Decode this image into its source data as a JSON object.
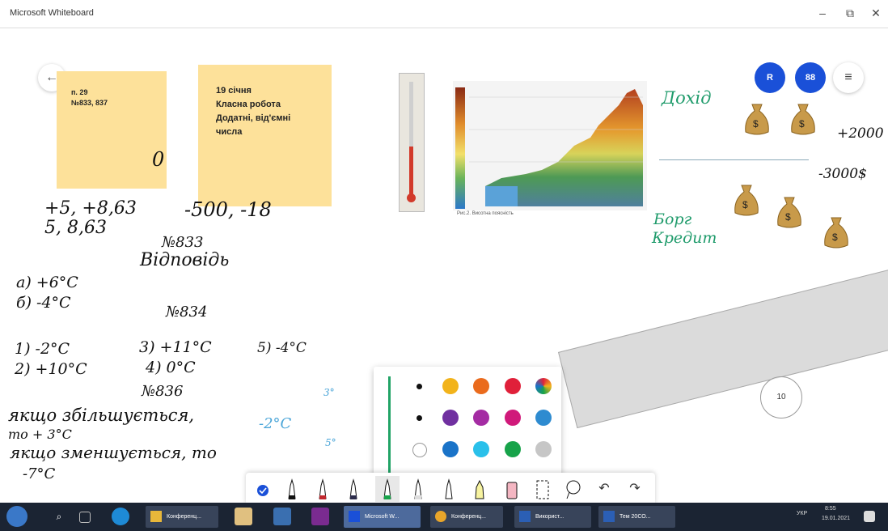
{
  "window": {
    "title": "Microsoft Whiteboard",
    "min": "–",
    "max": "⧉",
    "close": "✕"
  },
  "nav": {
    "back_icon": "←"
  },
  "sticky_notes": [
    {
      "lines": [
        "п. 29",
        "№833, 837"
      ]
    },
    {
      "lines": [
        "19 січня",
        "Класна робота",
        "Додатні, від'ємні",
        "числа"
      ]
    }
  ],
  "top_buttons": {
    "user_initials": "R",
    "second": "88",
    "menu": "≡"
  },
  "ink_notes": {
    "zero": "0",
    "pair1": "+5, +8,63",
    "pair2": "5, 8,63",
    "pair3": "-500, -18",
    "n833": "№833",
    "vidpovid": "Відповідь",
    "a": "а) +6°C",
    "b": "б) -4°C",
    "n834": "№834",
    "l1": "1) -2°C",
    "l2": "2) +10°C",
    "l3": "3) +11°C",
    "l4": "4) 0°C",
    "l5": "5) -4°C",
    "n836": "№836",
    "w1": "якщо збільшується,",
    "w2": "то + 3°C",
    "w3": "якщо зменшується, то",
    "w4": "-7°C",
    "minus2": "-2°C",
    "s3": "3°",
    "s5": "5°",
    "dohid": "Дохід",
    "plus2000": "+2000",
    "minus3000": "-3000$",
    "borg": "Борг",
    "kredyt": "Кредит"
  },
  "chart_caption": "Рис.2. Висотна поясність",
  "ruler": {
    "angle_label": "10"
  },
  "palette": {
    "swatches": [
      "#111111",
      "#f2b31b",
      "#ea6b1d",
      "#e0203a",
      "multi",
      "#111111",
      "#7030a0",
      "#a42ca3",
      "#d0197a",
      "#2e8bd0",
      "#ffffff",
      "#1a73c8",
      "#2ac0ea",
      "#17a34a",
      "#c6c6c6",
      "#e5e5e5",
      "#111111",
      "#bbbbbb",
      "#e8e8e8",
      "#c9a25c"
    ]
  },
  "toolbar": {
    "tools": [
      "check-circle",
      "pen-black",
      "pen-red",
      "pen-dark",
      "pen-green",
      "pen-gray",
      "pen-outline",
      "highlighter-yellow",
      "eraser-pink",
      "select",
      "lasso",
      "undo",
      "redo"
    ],
    "undo": "↶",
    "redo": "↷"
  },
  "taskbar": {
    "items": [
      "Конференц...",
      "Microsoft W...",
      "Конференц...",
      "Використ...",
      "Тем 20СО..."
    ],
    "lang": "УКР",
    "time": "8:55",
    "date": "19.01.2021"
  },
  "colors": {
    "sticky": "#fde19a",
    "accent": "#1a50d8",
    "taskbar": "#1b2433",
    "ink_green": "#1f9b6b"
  }
}
